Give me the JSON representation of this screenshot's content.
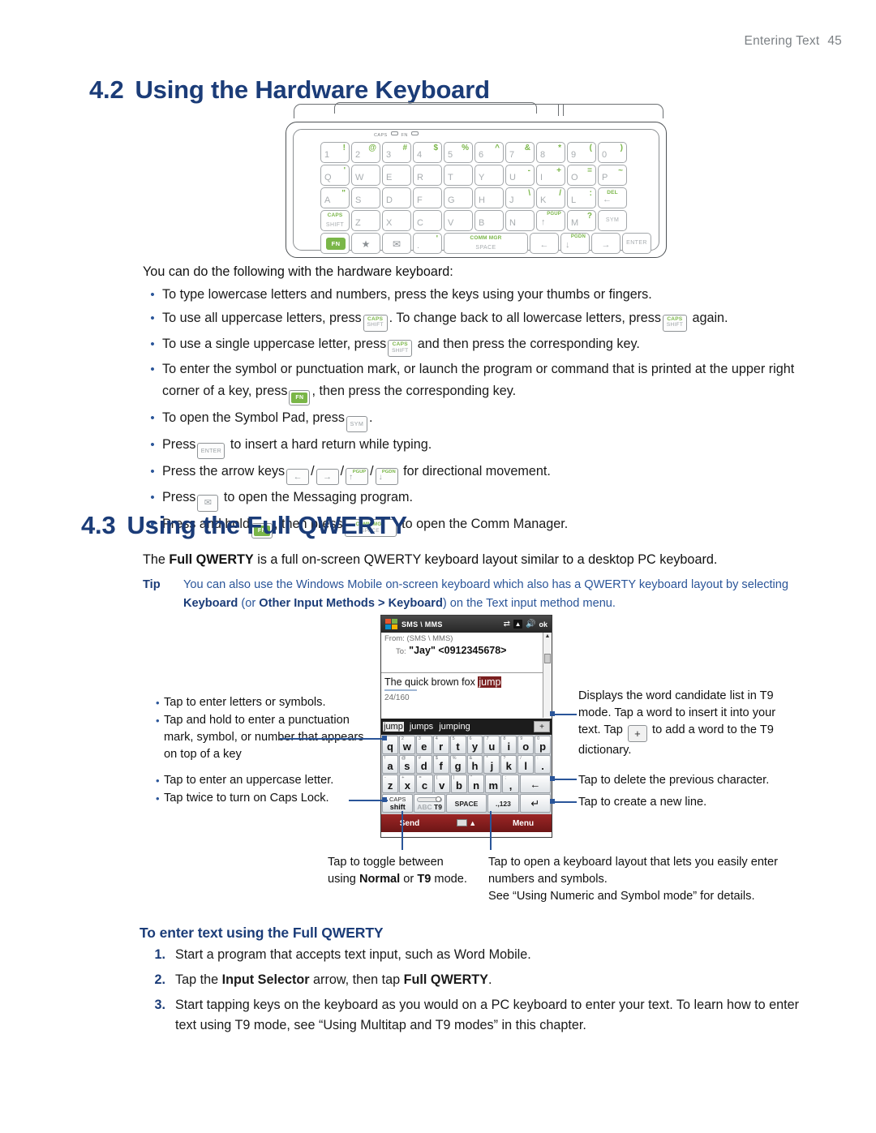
{
  "header": {
    "chapter": "Entering Text",
    "page": "45"
  },
  "section42": {
    "number": "4.2",
    "title": "Using the Hardware Keyboard",
    "intro": "You can do the following with the hardware keyboard:",
    "bullets": [
      {
        "pre": "To type lowercase letters and numbers, press the keys using your thumbs or fingers.",
        "post": ""
      },
      {
        "pre": "To use all uppercase letters, press",
        "mid": ". To change back to all lowercase letters, press",
        "post": "again."
      },
      {
        "pre": "To use a single uppercase letter, press",
        "post": "and then press the corresponding key."
      },
      {
        "pre": "To enter the symbol or punctuation mark, or launch the program or command that is printed at the upper right corner of a key, press",
        "post": ", then press the corresponding key."
      },
      {
        "pre": "To open the Symbol Pad, press",
        "post": "."
      },
      {
        "pre": "Press",
        "post": "to insert a hard return while typing."
      },
      {
        "pre": "Press the arrow keys",
        "post": "for directional movement."
      },
      {
        "pre": "Press",
        "post": "to open the Messaging program."
      },
      {
        "pre": "Press and hold",
        "mid": ", then press",
        "post": "to open the Comm Manager."
      }
    ]
  },
  "hardware_keyboard": {
    "leds": [
      "CAPS",
      "FN"
    ],
    "rows": [
      [
        {
          "main": "1",
          "alt": "!"
        },
        {
          "main": "2",
          "alt": "@"
        },
        {
          "main": "3",
          "alt": "#"
        },
        {
          "main": "4",
          "alt": "$"
        },
        {
          "main": "5",
          "alt": "%"
        },
        {
          "main": "6",
          "alt": "^"
        },
        {
          "main": "7",
          "alt": "&"
        },
        {
          "main": "8",
          "alt": "*"
        },
        {
          "main": "9",
          "alt": "("
        },
        {
          "main": "0",
          "alt": ")"
        }
      ],
      [
        {
          "main": "Q",
          "alt": "'"
        },
        {
          "main": "W",
          "alt": ""
        },
        {
          "main": "E",
          "alt": ""
        },
        {
          "main": "R",
          "alt": ""
        },
        {
          "main": "T",
          "alt": ""
        },
        {
          "main": "Y",
          "alt": ""
        },
        {
          "main": "U",
          "alt": "-"
        },
        {
          "main": "I",
          "alt": "+"
        },
        {
          "main": "O",
          "alt": "="
        },
        {
          "main": "P",
          "alt": "~"
        }
      ],
      [
        {
          "main": "A",
          "alt": "\""
        },
        {
          "main": "S",
          "alt": ""
        },
        {
          "main": "D",
          "alt": ""
        },
        {
          "main": "F",
          "alt": ""
        },
        {
          "main": "G",
          "alt": ""
        },
        {
          "main": "H",
          "alt": ""
        },
        {
          "main": "J",
          "alt": "\\"
        },
        {
          "main": "K",
          "alt": "/"
        },
        {
          "main": "L",
          "alt": ":"
        },
        {
          "type": "del",
          "topc": "DEL",
          "arrow": "←"
        }
      ],
      [
        {
          "type": "shift",
          "topc": "CAPS",
          "ctr2": "SHIFT"
        },
        {
          "main": "Z",
          "alt": ""
        },
        {
          "main": "X",
          "alt": ""
        },
        {
          "main": "C",
          "alt": ""
        },
        {
          "main": "V",
          "alt": ""
        },
        {
          "main": "B",
          "alt": ""
        },
        {
          "main": "N",
          "alt": ""
        },
        {
          "type": "pg",
          "altg": "PGUP",
          "arrow": "↑"
        },
        {
          "main": "M",
          "alt": "?"
        },
        {
          "type": "label",
          "ctr": "SYM"
        }
      ],
      [
        {
          "type": "fn",
          "chip": "FN"
        },
        {
          "type": "sym",
          "glyph": "★"
        },
        {
          "type": "sym",
          "glyph": "✉"
        },
        {
          "main": ".",
          "alt": "'"
        },
        {
          "type": "space",
          "topc": "COMM MGR",
          "ctr2": "SPACE"
        },
        {
          "type": "arrow",
          "arrow": "←"
        },
        {
          "type": "pg",
          "altg": "PGDN",
          "arrow": "↓"
        },
        {
          "type": "arrow",
          "arrow": "→"
        },
        {
          "type": "label",
          "ctr": "ENTER"
        }
      ]
    ]
  },
  "section43": {
    "number": "4.3",
    "title": "Using the Full QWERTY",
    "intro_a": "The ",
    "intro_b": "Full QWERTY",
    "intro_c": " is a full on-screen QWERTY keyboard layout similar to a desktop PC keyboard.",
    "tip_label": "Tip",
    "tip_line1": "You can also use the Windows Mobile on-screen keyboard which also has a QWERTY keyboard layout by selecting",
    "tip_kw1": "Keyboard",
    "tip_mid1": " (or ",
    "tip_kw2": "Other Input Methods > Keyboard",
    "tip_end": ") on the Text input method menu."
  },
  "phone": {
    "title": "SMS \\ MMS",
    "ok": "ok",
    "from_label": "From:",
    "from_value": "(SMS \\ MMS)",
    "to_label": "To:",
    "to_value": "\"Jay\" <0912345678>",
    "message_text": "The quick brown fox ",
    "message_highlight": "jump",
    "char_count": "24/160",
    "candidates": [
      "jump",
      "jumps",
      "jumping"
    ],
    "candidate_add": "+",
    "kb_row1": [
      {
        "sup": "1",
        "ltr": "q"
      },
      {
        "sup": "2",
        "ltr": "w"
      },
      {
        "sup": "3",
        "ltr": "e"
      },
      {
        "sup": "4",
        "ltr": "r"
      },
      {
        "sup": "5",
        "ltr": "t"
      },
      {
        "sup": "6",
        "ltr": "y"
      },
      {
        "sup": "7",
        "ltr": "u"
      },
      {
        "sup": "8",
        "ltr": "i"
      },
      {
        "sup": "9",
        "ltr": "o"
      },
      {
        "sup": "0",
        "ltr": "p"
      }
    ],
    "kb_row2": [
      {
        "sup": "!",
        "ltr": "a"
      },
      {
        "sup": "@",
        "ltr": "s"
      },
      {
        "sup": "#",
        "ltr": "d"
      },
      {
        "sup": "$",
        "ltr": "f"
      },
      {
        "sup": "%",
        "ltr": "g"
      },
      {
        "sup": "&",
        "ltr": "h"
      },
      {
        "sup": "*",
        "ltr": "j"
      },
      {
        "sup": "?",
        "ltr": "k"
      },
      {
        "sup": "/",
        "ltr": "l"
      },
      {
        "sup": ":",
        "ltr": "."
      }
    ],
    "kb_row3": [
      {
        "sup": "-",
        "ltr": "z"
      },
      {
        "sup": "+",
        "ltr": "x"
      },
      {
        "sup": "=",
        "ltr": "c"
      },
      {
        "sup": "(",
        "ltr": "v"
      },
      {
        "sup": "|",
        "ltr": "b"
      },
      {
        "sup": "\"",
        "ltr": "n"
      },
      {
        "sup": "",
        "ltr": "m"
      },
      {
        "sup": ";",
        "ltr": ","
      }
    ],
    "kb_backspace": "←",
    "kb_caps_top": "CAPS",
    "kb_caps_bot": "shift",
    "kb_t9_off": "ABC",
    "kb_t9_on": "T9",
    "kb_space": "SPACE",
    "kb_numsym": ".,123",
    "kb_enter": "↵",
    "softkey_left": "Send",
    "softkey_right": "Menu"
  },
  "callouts": {
    "left1": [
      "Tap to enter letters or symbols.",
      "Tap and hold to enter a punctuation mark, symbol, or number that appears on top of a key"
    ],
    "left2": [
      "Tap to enter an uppercase letter.",
      "Tap twice to turn on Caps Lock."
    ],
    "right1_a": "Displays the word candidate list in T9 mode. Tap a word to insert it into your text. Tap",
    "right1_b": "to add a word to the T9 dictionary.",
    "right2": "Tap to delete the previous character.",
    "right3": "Tap to create a new line.",
    "bot1_a": "Tap to toggle between using ",
    "bot1_b": "Normal",
    "bot1_c": " or ",
    "bot1_d": "T9",
    "bot1_e": " mode.",
    "bot2_line1": "Tap to open a keyboard layout that lets you easily enter numbers and symbols.",
    "bot2_line2": "See “Using Numeric and Symbol mode” for details."
  },
  "procedure": {
    "title": "To enter text using the Full QWERTY",
    "steps": [
      {
        "num": "1.",
        "a": "Start a program that accepts text input, such as Word Mobile.",
        "b": "",
        "c": "",
        "d": "",
        "e": ""
      },
      {
        "num": "2.",
        "a": "Tap the ",
        "b": "Input Selector",
        "c": " arrow, then tap ",
        "d": "Full QWERTY",
        "e": "."
      },
      {
        "num": "3.",
        "a": "Start tapping keys on the keyboard as you would on a PC keyboard to enter your text. To learn how to enter text using T9 mode, see “Using Multitap and T9 modes” in this chapter.",
        "b": "",
        "c": "",
        "d": "",
        "e": ""
      }
    ]
  },
  "colors": {
    "heading_blue": "#1b3c78",
    "accent_blue": "#2a5599",
    "key_green": "#7ab648",
    "softkey_red": "#8d1f1f"
  }
}
